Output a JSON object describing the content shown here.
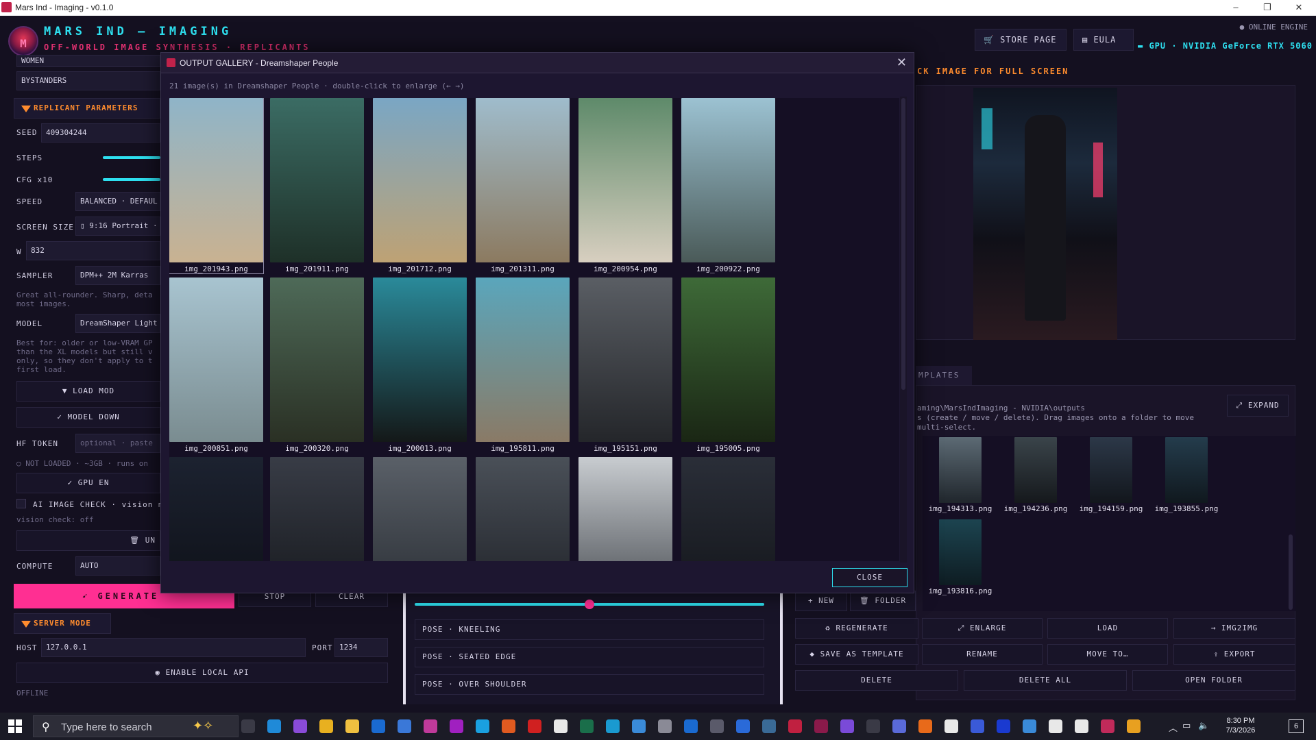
{
  "window": {
    "title": "Mars Ind - Imaging  -  v0.1.0"
  },
  "header": {
    "brand_title": "MARS IND — IMAGING",
    "brand_sub": "OFF-WORLD IMAGE SYNTHESIS · REPLICANTS",
    "store_label": "STORE PAGE",
    "eula_label": "EULA",
    "online_label": "● ONLINE ENGINE",
    "gpu_label": "▬ GPU · NVIDIA GeForce RTX 5060"
  },
  "left": {
    "women_label": "WOMEN",
    "bystanders_label": "BYSTANDERS",
    "replicant_header": "REPLICANT PARAMETERS",
    "seed_label": "SEED",
    "seed_value": "409304244",
    "steps_label": "STEPS",
    "cfg_label": "CFG x10",
    "speed_label": "SPEED",
    "speed_value": "BALANCED · DEFAUL",
    "screen_size_label": "SCREEN SIZE",
    "screen_size_value": "▯ 9:16 Portrait ·",
    "w_label": "W",
    "w_value": "832",
    "sampler_label": "SAMPLER",
    "sampler_value": "DPM++ 2M Karras",
    "sampler_help": "Great all-rounder. Sharp, deta most images.",
    "model_label": "MODEL",
    "model_value": "DreamShaper Light",
    "model_help": "Best for: older or low-VRAM GP than the XL models but still v only, so they don't apply to t first load.",
    "load_model_label": "▼ LOAD MOD",
    "model_download_label": "✓ MODEL DOWN",
    "hf_token_label": "HF TOKEN",
    "hf_token_placeholder": "optional · paste",
    "not_loaded_text": "○ NOT LOADED · ~3GB · runs on",
    "gpu_enable_label": "✓ GPU EN",
    "ai_check_label": "AI IMAGE CHECK · vision mo",
    "vision_status": "vision check: off",
    "unload_label": "🗑 UN",
    "compute_label": "COMPUTE",
    "compute_value": "AUTO",
    "generate_label": "GENERATE",
    "stop_label": "STOP",
    "clear_label": "CLEAR",
    "server_header": "SERVER MODE",
    "host_label": "HOST",
    "host_value": "127.0.0.1",
    "port_label": "PORT",
    "port_value": "1234",
    "enable_api_label": "◉ ENABLE LOCAL API",
    "offline_text": "OFFLINE"
  },
  "modal": {
    "title": "OUTPUT GALLERY - Dreamshaper People",
    "info": "21 image(s) in Dreamshaper People · double-click to enlarge (← →)",
    "close_label": "CLOSE",
    "images": [
      {
        "name": "img_201943.png"
      },
      {
        "name": "img_201911.png"
      },
      {
        "name": "img_201712.png"
      },
      {
        "name": "img_201311.png"
      },
      {
        "name": "img_200954.png"
      },
      {
        "name": "img_200922.png"
      },
      {
        "name": "img_200851.png"
      },
      {
        "name": "img_200320.png"
      },
      {
        "name": "img_200013.png"
      },
      {
        "name": "img_195811.png"
      },
      {
        "name": "img_195151.png"
      },
      {
        "name": "img_195005.png"
      },
      {
        "name": ""
      },
      {
        "name": ""
      },
      {
        "name": ""
      },
      {
        "name": ""
      },
      {
        "name": ""
      },
      {
        "name": ""
      }
    ]
  },
  "middle": {
    "poses": [
      "POSE · KNEELING",
      "POSE · SEATED EDGE",
      "POSE · OVER SHOULDER"
    ],
    "slider_value": 0.49
  },
  "right": {
    "preview_hint": "CK IMAGE FOR FULL SCREEN",
    "templates_tab": "MPLATES",
    "expand_label": "⤢ EXPAND",
    "path_text": "aming\\MarsIndImaging - NVIDIA\\outputs",
    "info_text": "s (create / move / delete). Drag images onto a folder to move",
    "info_text2": " multi-select.",
    "templates": [
      {
        "name": "img_194313.png"
      },
      {
        "name": "img_194236.png"
      },
      {
        "name": "img_194159.png"
      },
      {
        "name": "img_193855.png"
      },
      {
        "name": "img_193816.png"
      }
    ],
    "new_label": "+ NEW",
    "folder_label": "🗑 FOLDER",
    "regenerate_label": "♻ REGENERATE",
    "enlarge_label": "⤢ ENLARGE",
    "load_label": "LOAD",
    "img2img_label": "→ IMG2IMG",
    "save_template_label": "◆ SAVE AS TEMPLATE",
    "rename_label": "RENAME",
    "move_to_label": "MOVE TO…",
    "export_label": "⇪ EXPORT",
    "delete_label": "DELETE",
    "delete_all_label": "DELETE ALL",
    "open_folder_label": "OPEN FOLDER"
  },
  "taskbar": {
    "search_placeholder": "Type here to search",
    "time": "8:30 PM",
    "date": "7/3/2026",
    "notification_count": "6"
  },
  "colors": {
    "accent_cyan": "#2ee0f0",
    "accent_pink": "#ff2f92",
    "accent_orange": "#ff8c2e",
    "bg": "#141020"
  }
}
